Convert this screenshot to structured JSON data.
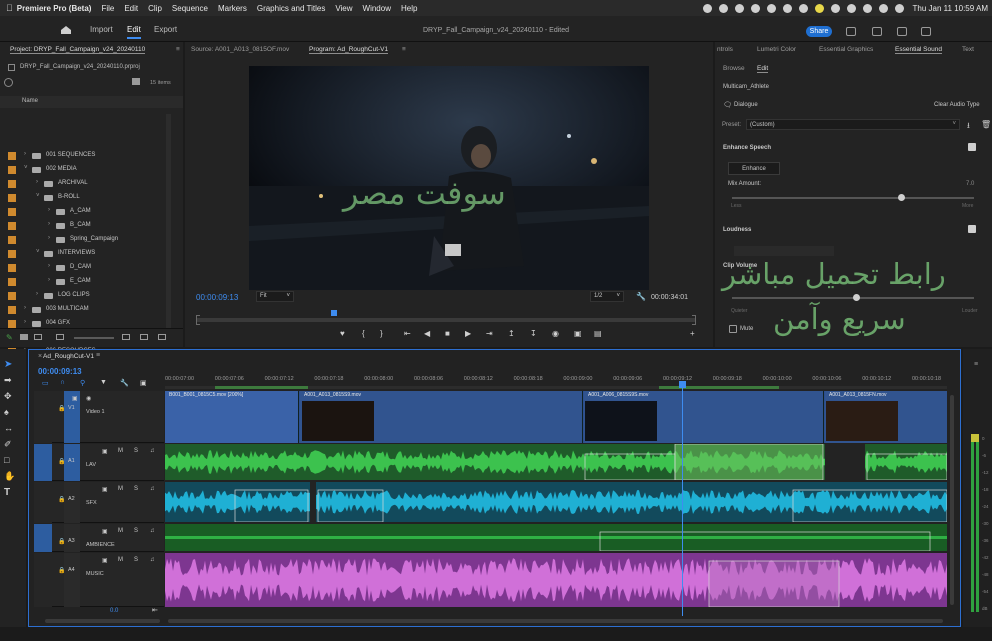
{
  "menubar": {
    "app_name": "Premiere Pro (Beta)",
    "items": [
      "File",
      "Edit",
      "Clip",
      "Sequence",
      "Markers",
      "Graphics and Titles",
      "View",
      "Window",
      "Help"
    ],
    "datetime": "Thu Jan 11  10:59 AM"
  },
  "header": {
    "tabs": [
      "Import",
      "Edit",
      "Export"
    ],
    "active_tab": "Edit",
    "document_title": "DRYP_Fall_Campaign_v24_20240110 - Edited",
    "share_label": "Share"
  },
  "project_panel": {
    "tab_project": "Project: DRYP_Fall_Campaign_v24_20240110",
    "file_name": "DRYP_Fall_Campaign_v24_20240110.prproj",
    "item_count": "15 items",
    "column_name": "Name",
    "items": [
      {
        "label": "001 SEQUENCES",
        "level": 0,
        "open": false
      },
      {
        "label": "002 MEDIA",
        "level": 0,
        "open": true
      },
      {
        "label": "ARCHIVAL",
        "level": 1,
        "open": false
      },
      {
        "label": "B-ROLL",
        "level": 1,
        "open": true
      },
      {
        "label": "A_CAM",
        "level": 2,
        "open": false
      },
      {
        "label": "B_CAM",
        "level": 2,
        "open": false
      },
      {
        "label": "Spring_Campaign",
        "level": 2,
        "open": false
      },
      {
        "label": "INTERVIEWS",
        "level": 1,
        "open": true
      },
      {
        "label": "D_CAM",
        "level": 2,
        "open": false
      },
      {
        "label": "E_CAM",
        "level": 2,
        "open": false
      },
      {
        "label": "LOG CLIPS",
        "level": 1,
        "open": false
      },
      {
        "label": "003 MULTICAM",
        "level": 0,
        "open": false
      },
      {
        "label": "004 GFX",
        "level": 0,
        "open": false
      },
      {
        "label": "005 AUDIO",
        "level": 0,
        "open": false
      },
      {
        "label": "006 RESOURCES",
        "level": 0,
        "open": false
      }
    ]
  },
  "source_monitor": {
    "tab": "Source: A001_A013_0815OF.mov"
  },
  "program_monitor": {
    "tab": "Program: Ad_RoughCut-V1",
    "timecode_current": "00:00:09:13",
    "zoom": "Fit",
    "resolution": "1/2",
    "timecode_duration": "00:00:34:01"
  },
  "right_panel": {
    "tabs": [
      "ntrols",
      "Lumetri Color",
      "Essential Graphics",
      "Essential Sound",
      "Text"
    ],
    "active_tab": "Essential Sound",
    "subtabs": [
      "Browse",
      "Edit"
    ],
    "active_subtab": "Edit",
    "clip_name": "Multicam_Athlete",
    "type_label": "Dialogue",
    "clear_label": "Clear Audio Type",
    "preset_label": "Preset:",
    "preset_value": "(Custom)",
    "enhance_speech": "Enhance Speech",
    "enhance_button": "Enhance",
    "mix_amount": "Mix Amount:",
    "mix_value": "7.0",
    "mix_min": "Less",
    "mix_max": "More",
    "loudness": "Loudness",
    "clip_volume": "Clip Volume",
    "volume_min": "Quieter",
    "volume_max": "Louder",
    "mute": "Mute"
  },
  "overlays": {
    "video_text": "سوفت مصر",
    "panel_text_1": "رابط تحميل مباشر",
    "panel_text_2": "سريع وآمن"
  },
  "timeline": {
    "tab": "Ad_RoughCut-V1",
    "timecode": "00:00:09:13",
    "playhead_time": "00:00:09:12",
    "ruler": [
      "00:00:07:00",
      "00:00:07:06",
      "00:00:07:12",
      "00:00:07:18",
      "00:00:08:00",
      "00:00:08:06",
      "00:00:08:12",
      "00:00:08:18",
      "00:00:09:00",
      "00:00:09:06",
      "00:00:09:12",
      "00:00:09:18",
      "00:00:10:00",
      "00:00:10:06",
      "00:00:10:12",
      "00:00:10:18"
    ],
    "tracks": [
      {
        "id": "V1",
        "name": "Video 1"
      },
      {
        "id": "A1",
        "name": "LAV"
      },
      {
        "id": "A2",
        "name": "SFX"
      },
      {
        "id": "A3",
        "name": "AMBIENCE"
      },
      {
        "id": "A4",
        "name": "MUSIC"
      }
    ],
    "clips": [
      "B001_B001_0815C5.mov [200%]",
      "A001_A013_0815S9.mov",
      "A001_A006_0815S9S.mov",
      "A001_A013_0815FN.mov"
    ],
    "footer_value": "0.0",
    "mix_label": "Mix"
  },
  "meters": [
    "0",
    "-6",
    "-12",
    "-18",
    "-24",
    "-30",
    "-36",
    "-42",
    "-48",
    "-54",
    "dB"
  ],
  "colors": {
    "video_clip": "#2c4f8f",
    "lav_green": "#2fa13f",
    "sfx_blue": "#1ba6c8",
    "ambience_green": "#1f8a2e",
    "music_purple": "#b04bbf",
    "playhead": "#3e8cf0",
    "accent": "#1f6fd1"
  }
}
